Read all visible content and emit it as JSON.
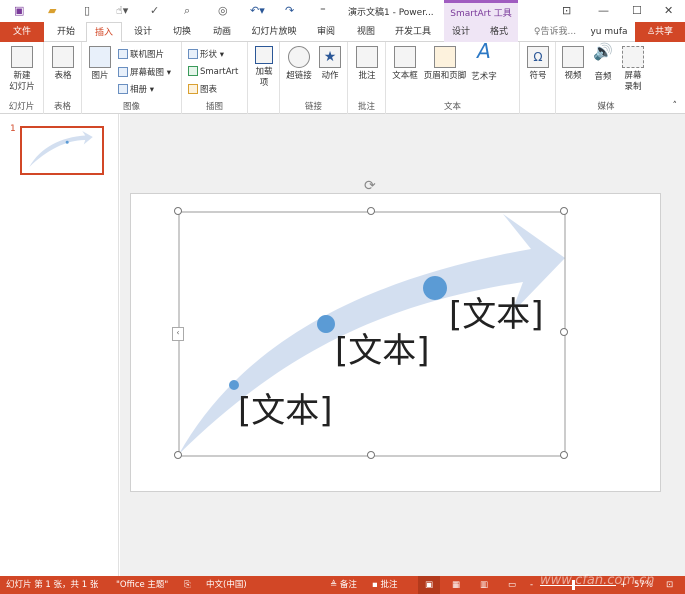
{
  "title_bar": {
    "title": "演示文稿1 - Power...",
    "context_tool": "SmartArt 工具",
    "quick_access": [
      "save-icon",
      "open-icon",
      "new-icon",
      "touch-mode-icon",
      "spelling-icon",
      "print-preview-icon",
      "present-icon",
      "undo-icon",
      "redo-icon",
      "customize-icon"
    ],
    "window_buttons": [
      "ribbon-display-icon",
      "minimize-icon",
      "maximize-icon",
      "close-icon"
    ]
  },
  "tabs": {
    "file": "文件",
    "items": [
      "开始",
      "插入",
      "设计",
      "切换",
      "动画",
      "幻灯片放映",
      "审阅",
      "视图",
      "开发工具",
      "设计",
      "格式"
    ],
    "active": "插入",
    "tell_me": "告诉我...",
    "user": "yu mufa",
    "share": "共享"
  },
  "ribbon": {
    "groups": [
      {
        "label": "幻灯片",
        "buttons": [
          "新建\n幻灯片"
        ]
      },
      {
        "label": "表格",
        "buttons": [
          "表格"
        ]
      },
      {
        "label": "图像",
        "buttons": [
          "图片"
        ],
        "small": [
          "联机图片",
          "屏幕截图",
          "相册"
        ]
      },
      {
        "label": "插图",
        "small": [
          "形状",
          "SmartArt",
          "图表"
        ]
      },
      {
        "label": "",
        "buttons": [
          "加载\n项"
        ]
      },
      {
        "label": "链接",
        "buttons": [
          "超链接",
          "动作"
        ]
      },
      {
        "label": "批注",
        "buttons": [
          "批注"
        ]
      },
      {
        "label": "文本",
        "buttons": [
          "文本框",
          "页眉和页脚",
          "艺术字"
        ]
      },
      {
        "label": "",
        "buttons": [
          "符号"
        ]
      },
      {
        "label": "媒体",
        "buttons": [
          "视频",
          "音频",
          "屏幕\n录制"
        ]
      }
    ]
  },
  "thumbnails": [
    {
      "number": "1"
    }
  ],
  "slide": {
    "texts": [
      "[文本]",
      "[文本]",
      "[文本]"
    ],
    "arrow_color": "#d3dff0",
    "dot_color": "#5b9bd5"
  },
  "status_bar": {
    "slide_info": "幻灯片 第 1 张，共 1 张",
    "theme": "\"Office 主题\"",
    "language": "中文(中国)",
    "notes": "备注",
    "comments": "批注",
    "zoom": "57%",
    "watermark": "www.cfan.com.cn"
  },
  "colors": {
    "accent": "#d24726",
    "context": "#efe5f5"
  }
}
